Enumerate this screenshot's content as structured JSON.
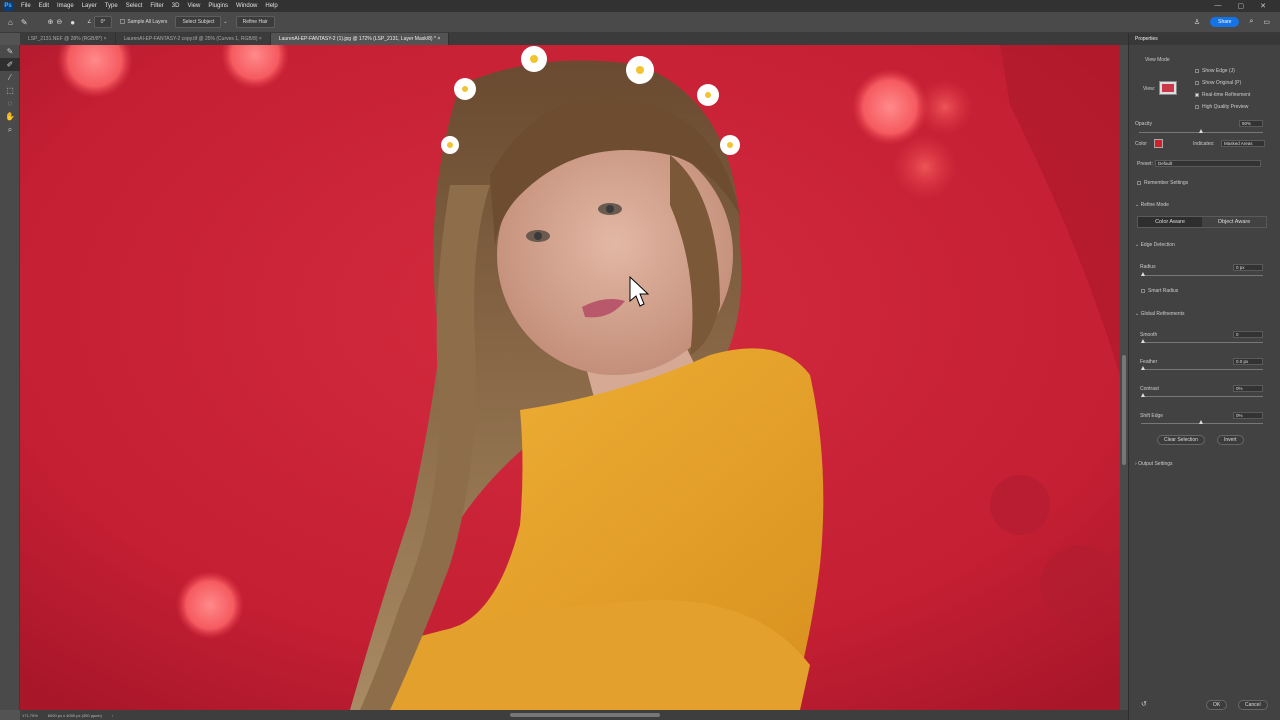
{
  "menu": {
    "logo": "Ps",
    "items": [
      "File",
      "Edit",
      "Image",
      "Layer",
      "Type",
      "Select",
      "Filter",
      "3D",
      "View",
      "Plugins",
      "Window",
      "Help"
    ]
  },
  "options": {
    "angle": "0°",
    "sample_all_layers": "Sample All Layers",
    "select_subject": "Select Subject",
    "refine_hair": "Refine Hair",
    "share": "Share"
  },
  "tabs": [
    "LSP_2131.NEF @ 28% (RGB/8*)",
    "LaurenAI-EP-FANTASY-2 copy.tif @ 25% (Curves 1, RGB/8)",
    "LaurenAI-EP-FANTASY-2 (1).jpg @ 172% (LSP_2131, Layer Mask/8) *"
  ],
  "status": {
    "zoom": "171.75%",
    "doc_size": "6000 px x 4000 px (300 ppcm)"
  },
  "properties": {
    "title": "Properties",
    "view_mode": "View Mode",
    "view_label": "View:",
    "show_edge": "Show Edge (J)",
    "show_original": "Show Original (P)",
    "realtime_refinement": "Real-time Refinement",
    "high_quality_preview": "High Quality Preview",
    "opacity_label": "Opacity",
    "opacity_value": "50%",
    "opacity_level": 0.5,
    "color_label": "Color",
    "overlay_color": "#d0202e",
    "indicates_label": "Indicates:",
    "indicates_value": "Masked Areas",
    "preset_label": "Preset:",
    "preset_value": "Default",
    "remember_settings": "Remember Settings",
    "refine_mode": "Refine Mode",
    "color_aware": "Color Aware",
    "object_aware": "Object Aware",
    "edge_detection": "Edge Detection",
    "radius_label": "Radius",
    "radius_value": "0 px",
    "smart_radius": "Smart Radius",
    "global_refinements": "Global Refinements",
    "smooth_label": "Smooth",
    "smooth_value": "0",
    "feather_label": "Feather",
    "feather_value": "0.0 px",
    "contrast_label": "Contrast",
    "contrast_value": "0%",
    "shift_edge_label": "Shift Edge",
    "shift_edge_value": "0%",
    "clear_selection": "Clear Selection",
    "invert": "Invert",
    "output_settings": "Output Settings",
    "ok": "OK",
    "cancel": "Cancel"
  },
  "icons": [
    "home-icon",
    "brush-icon",
    "refine-edge-brush-icon",
    "lasso-icon",
    "hand-icon",
    "zoom-icon",
    "reset-icon",
    "cursor-icon"
  ]
}
